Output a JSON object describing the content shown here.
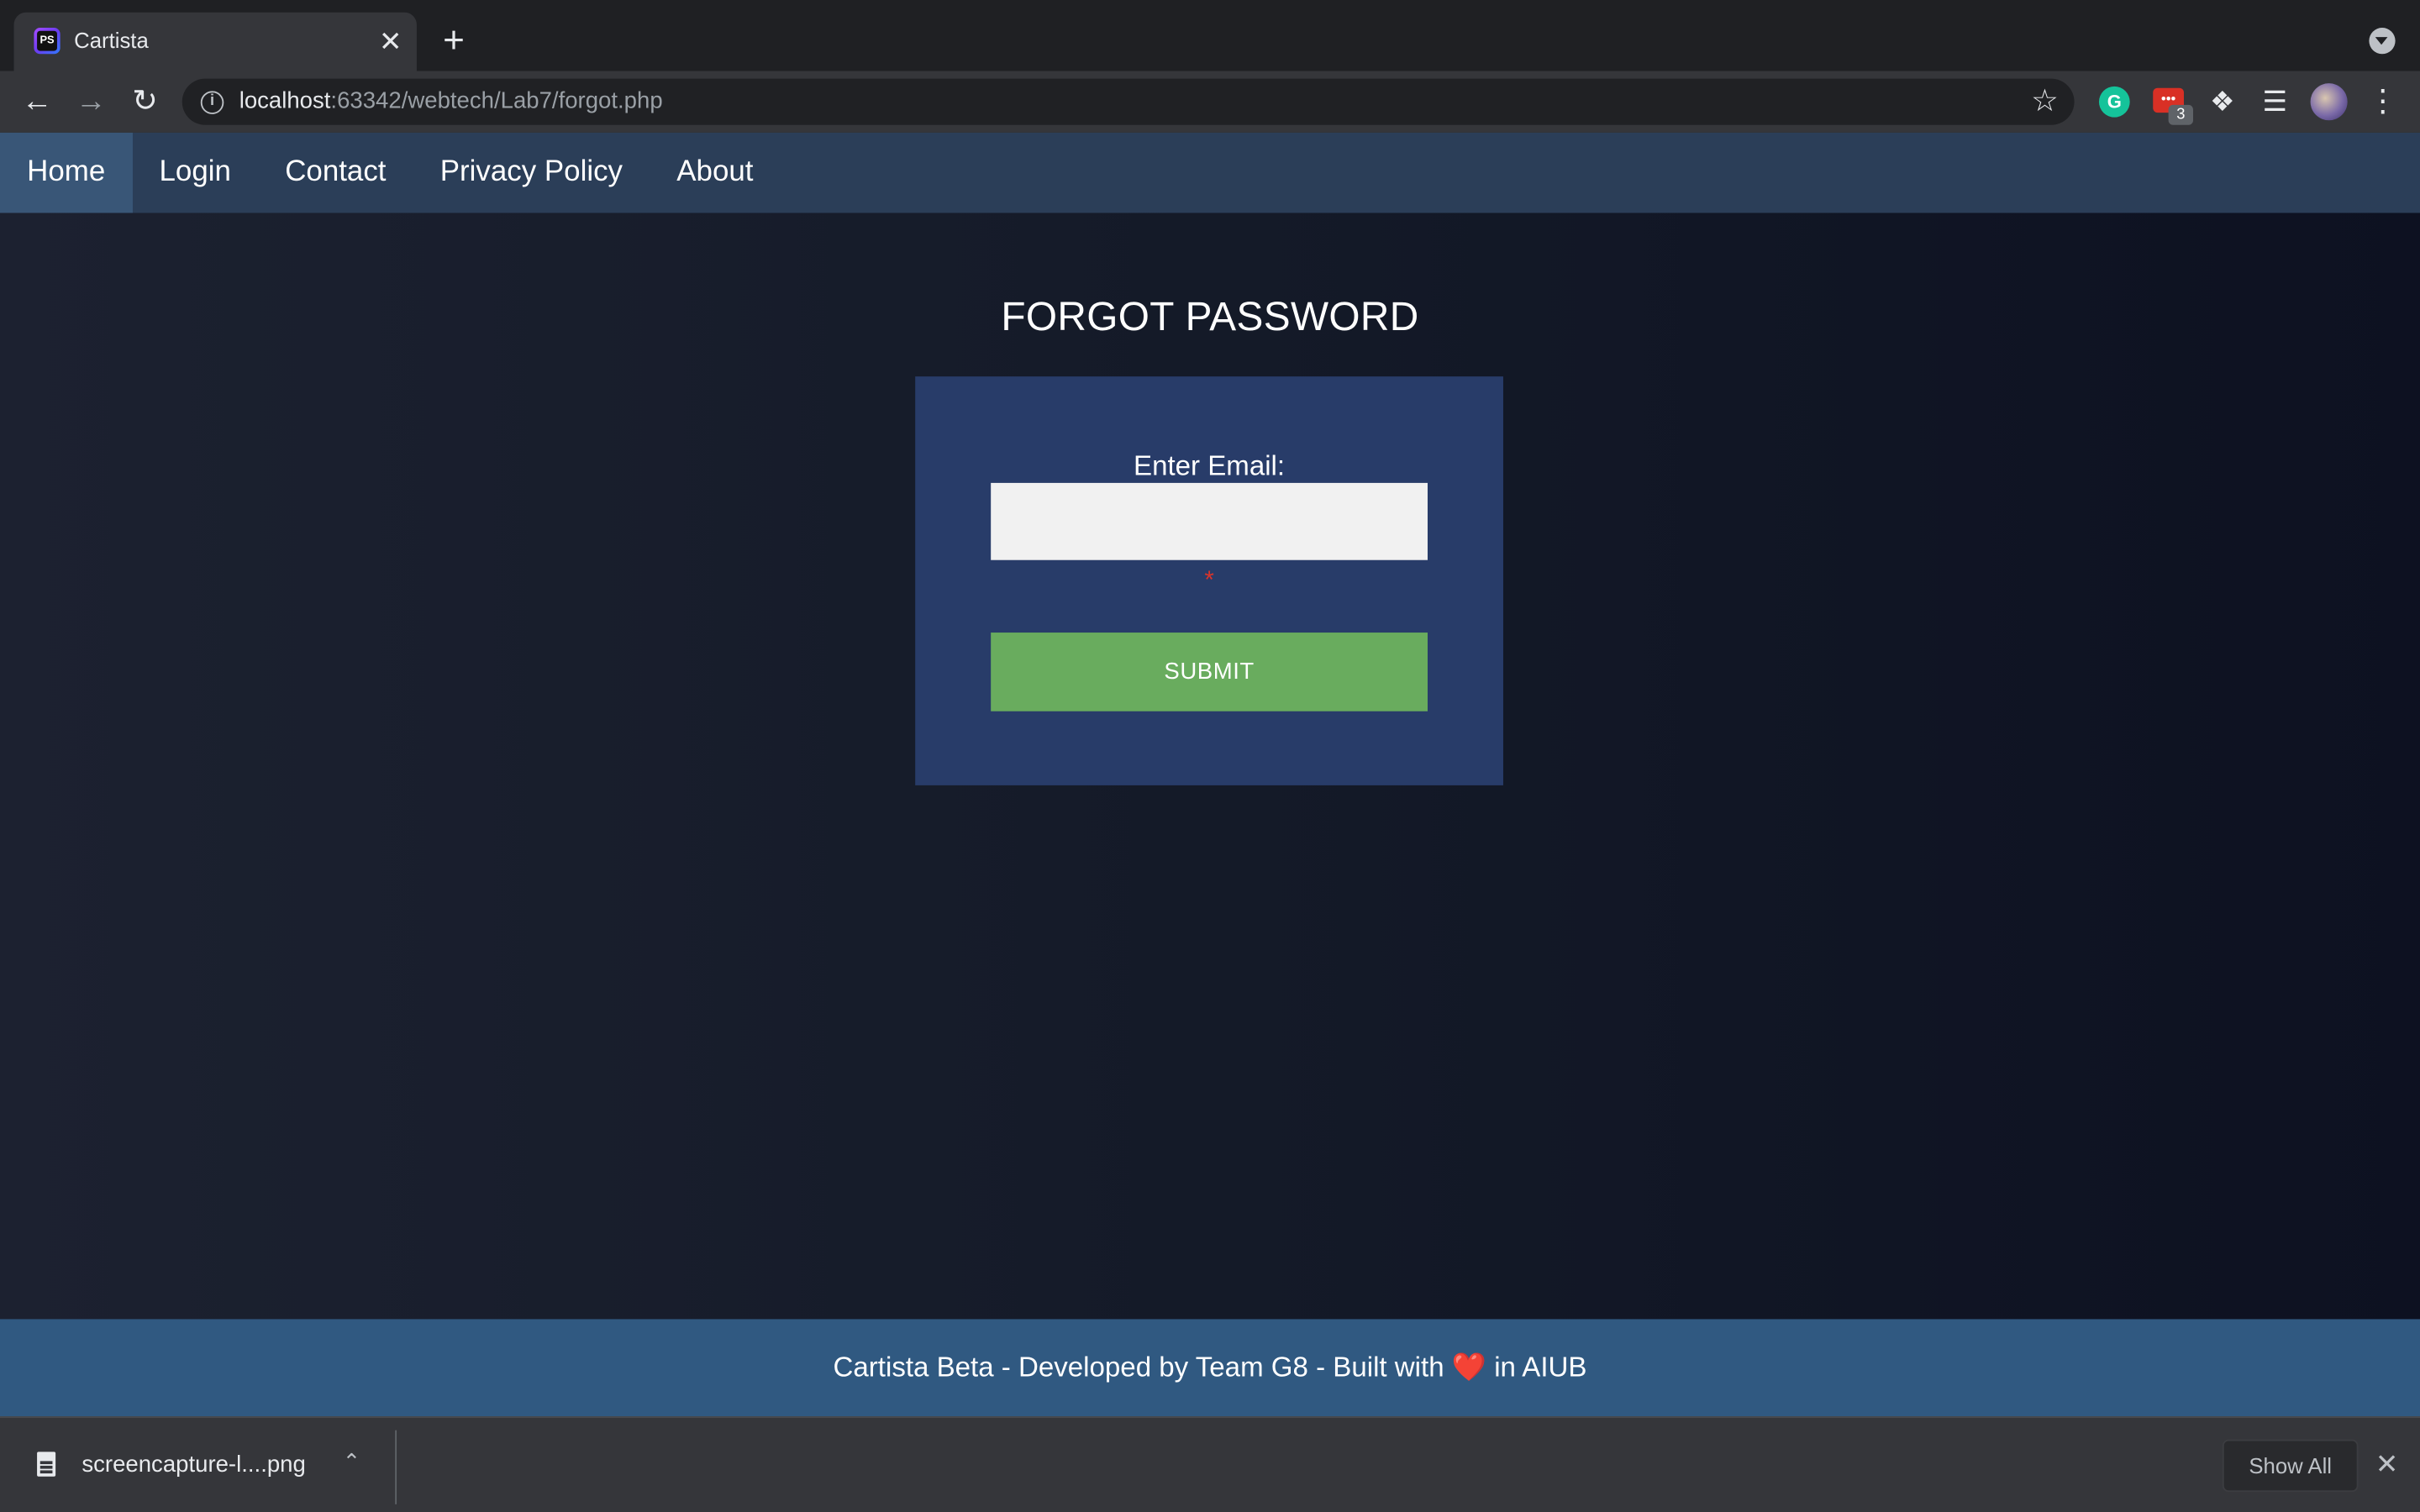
{
  "browser": {
    "tab_title": "Cartista",
    "favicon_text": "PS",
    "tab_close": "✕",
    "new_tab": "+",
    "url_host": "localhost",
    "url_rest": ":63342/webtech/Lab7/forgot.php",
    "icons": [
      "back-icon",
      "forward-icon",
      "reload-icon",
      "info-icon",
      "star-icon",
      "grammarly-icon",
      "extension-icon",
      "puzzle-icon",
      "media-control-icon",
      "avatar",
      "menu-icon"
    ],
    "extension_badge": "3",
    "grammarly_letter": "G"
  },
  "site_nav": {
    "items": [
      {
        "label": "Home",
        "active": true
      },
      {
        "label": "Login",
        "active": false
      },
      {
        "label": "Contact",
        "active": false
      },
      {
        "label": "Privacy Policy",
        "active": false
      },
      {
        "label": "About",
        "active": false
      }
    ]
  },
  "form": {
    "title": "FORGOT PASSWORD",
    "email_label": "Enter Email:",
    "email_value": "",
    "required_mark": "*",
    "submit_label": "SUBMIT"
  },
  "footer": {
    "text_before": "Cartista Beta - Developed by Team G8 - Built with",
    "heart": "❤️",
    "text_after": " in AIUB"
  },
  "download_shelf": {
    "file_name": "screencapture-l....png",
    "show_all_label": "Show All"
  },
  "colors": {
    "nav_bg": "#2b3e58",
    "nav_active": "#395677",
    "card_bg": "#283c69",
    "submit_bg": "#69ac5e",
    "footer_bg": "#305981",
    "required": "#d9342b"
  }
}
